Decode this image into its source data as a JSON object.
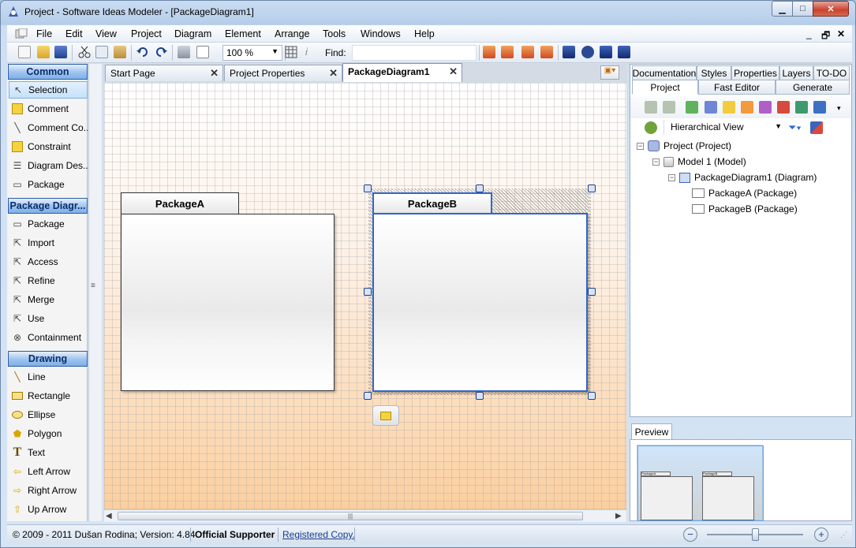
{
  "window": {
    "title": "Project - Software Ideas Modeler - [PackageDiagram1]",
    "minimize_label": "▁",
    "maximize_label": "□",
    "close_label": "✕"
  },
  "menu": [
    "File",
    "Edit",
    "View",
    "Project",
    "Diagram",
    "Element",
    "Arrange",
    "Tools",
    "Windows",
    "Help"
  ],
  "mdi_controls": [
    "_",
    "🗗",
    "✕"
  ],
  "toolbar": {
    "zoom_value": "100 %",
    "find_label": "Find:",
    "find_value": ""
  },
  "toolbox": {
    "groups": [
      {
        "title": "Common",
        "items": [
          "Selection",
          "Comment",
          "Comment  Co...",
          "Constraint",
          "Diagram Des...",
          "Package"
        ]
      },
      {
        "title": "Package Diagr...",
        "items": [
          "Package",
          "Import",
          "Access",
          "Refine",
          "Merge",
          "Use",
          "Containment"
        ]
      },
      {
        "title": "Drawing",
        "items": [
          "Line",
          "Rectangle",
          "Ellipse",
          "Polygon",
          "Text",
          "Left Arrow",
          "Right Arrow",
          "Up Arrow"
        ]
      }
    ],
    "selected": "Selection"
  },
  "doc_tabs": [
    {
      "label": "Start Page",
      "active": false
    },
    {
      "label": "Project Properties",
      "active": false
    },
    {
      "label": "PackageDiagram1",
      "active": true
    }
  ],
  "diagram": {
    "packages": [
      {
        "name": "PackageA",
        "selected": false
      },
      {
        "name": "PackageB",
        "selected": true
      }
    ]
  },
  "right_panel": {
    "tabs_row1": [
      "Documentation",
      "Styles",
      "Properties",
      "Layers",
      "TO-DO"
    ],
    "tabs_row2": [
      "Project",
      "Fast Editor",
      "Generate"
    ],
    "active_tab": "Project",
    "view_select": "Hierarchical View",
    "tree": [
      {
        "label": "Project (Project)",
        "level": 0,
        "expand": "−"
      },
      {
        "label": "Model 1 (Model)",
        "level": 1,
        "expand": "−"
      },
      {
        "label": "PackageDiagram1 (Diagram)",
        "level": 2,
        "expand": "−"
      },
      {
        "label": "PackageA (Package)",
        "level": 3,
        "expand": ""
      },
      {
        "label": "PackageB (Package)",
        "level": 3,
        "expand": ""
      }
    ]
  },
  "preview": {
    "tab_label": "Preview",
    "mini_labels": [
      "PackageA",
      "PackageB"
    ]
  },
  "status": {
    "copyright": "© 2009 - 2011 Dušan Rodina; Version: 4.84",
    "supporter": "Official Supporter",
    "registered": "Registered Copy.",
    "zoom_out": "−",
    "zoom_in": "+"
  },
  "colors": {
    "accent": "#2b5aa8",
    "selection_border": "#2f67c9",
    "canvas_gradient_bottom": "#fbcf9f"
  }
}
